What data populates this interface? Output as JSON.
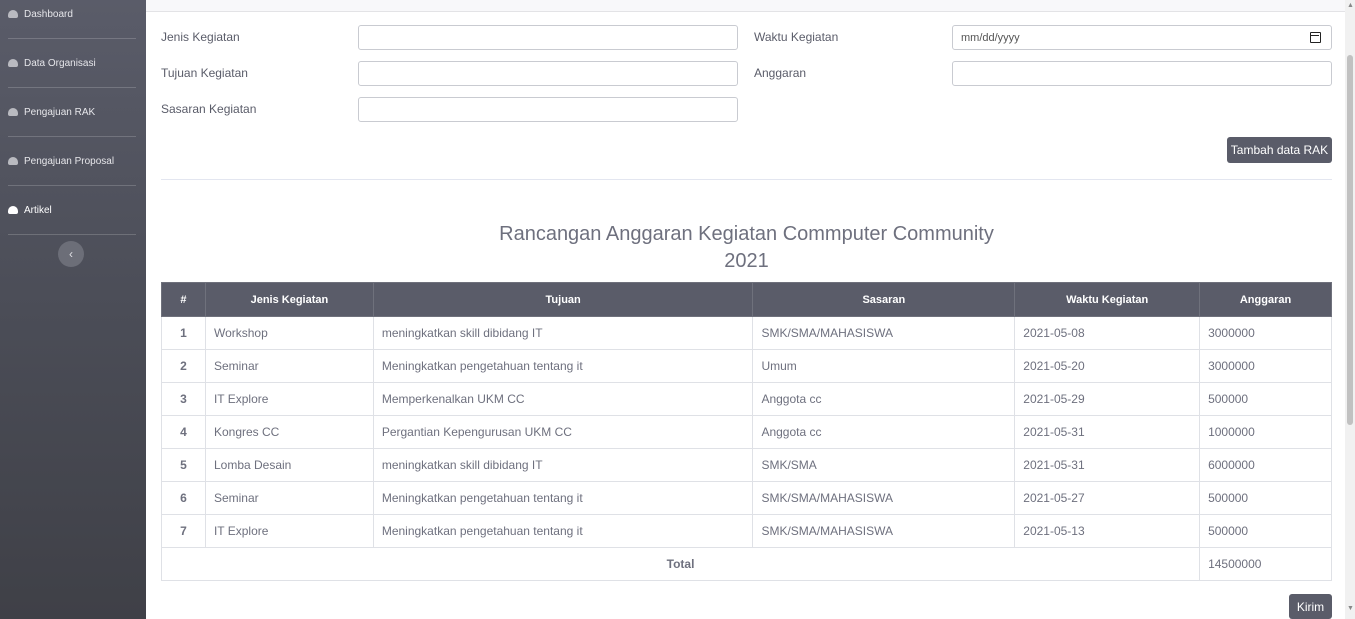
{
  "sidebar": {
    "items": [
      {
        "label": "Dashboard"
      },
      {
        "label": "Data Organisasi"
      },
      {
        "label": "Pengajuan RAK"
      },
      {
        "label": "Pengajuan Proposal"
      },
      {
        "label": "Artikel"
      }
    ],
    "toggle_icon": "chevron-left-icon"
  },
  "form": {
    "jenis_label": "Jenis Kegiatan",
    "tujuan_label": "Tujuan Kegiatan",
    "sasaran_label": "Sasaran Kegiatan",
    "waktu_label": "Waktu Kegiatan",
    "waktu_placeholder": "mm/dd/yyyy",
    "anggaran_label": "Anggaran",
    "add_button": "Tambah data RAK"
  },
  "report": {
    "title_line1": "Rancangan Anggaran Kegiatan Commputer Community",
    "title_line2": "2021",
    "headers": [
      "#",
      "Jenis Kegiatan",
      "Tujuan",
      "Sasaran",
      "Waktu Kegiatan",
      "Anggaran"
    ],
    "rows": [
      [
        "1",
        "Workshop",
        "meningkatkan skill dibidang IT",
        "SMK/SMA/MAHASISWA",
        "2021-05-08",
        "3000000"
      ],
      [
        "2",
        "Seminar",
        "Meningkatkan pengetahuan tentang it",
        "Umum",
        "2021-05-20",
        "3000000"
      ],
      [
        "3",
        "IT Explore",
        "Memperkenalkan UKM CC",
        "Anggota cc",
        "2021-05-29",
        "500000"
      ],
      [
        "4",
        "Kongres CC",
        "Pergantian Kepengurusan UKM CC",
        "Anggota cc",
        "2021-05-31",
        "1000000"
      ],
      [
        "5",
        "Lomba Desain",
        "meningkatkan skill dibidang IT",
        "SMK/SMA",
        "2021-05-31",
        "6000000"
      ],
      [
        "6",
        "Seminar",
        "Meningkatkan pengetahuan tentang it",
        "SMK/SMA/MAHASISWA",
        "2021-05-27",
        "500000"
      ],
      [
        "7",
        "IT Explore",
        "Meningkatkan pengetahuan tentang it",
        "SMK/SMA/MAHASISWA",
        "2021-05-13",
        "500000"
      ]
    ],
    "total_label": "Total",
    "total_value": "14500000",
    "send_button": "Kirim"
  }
}
